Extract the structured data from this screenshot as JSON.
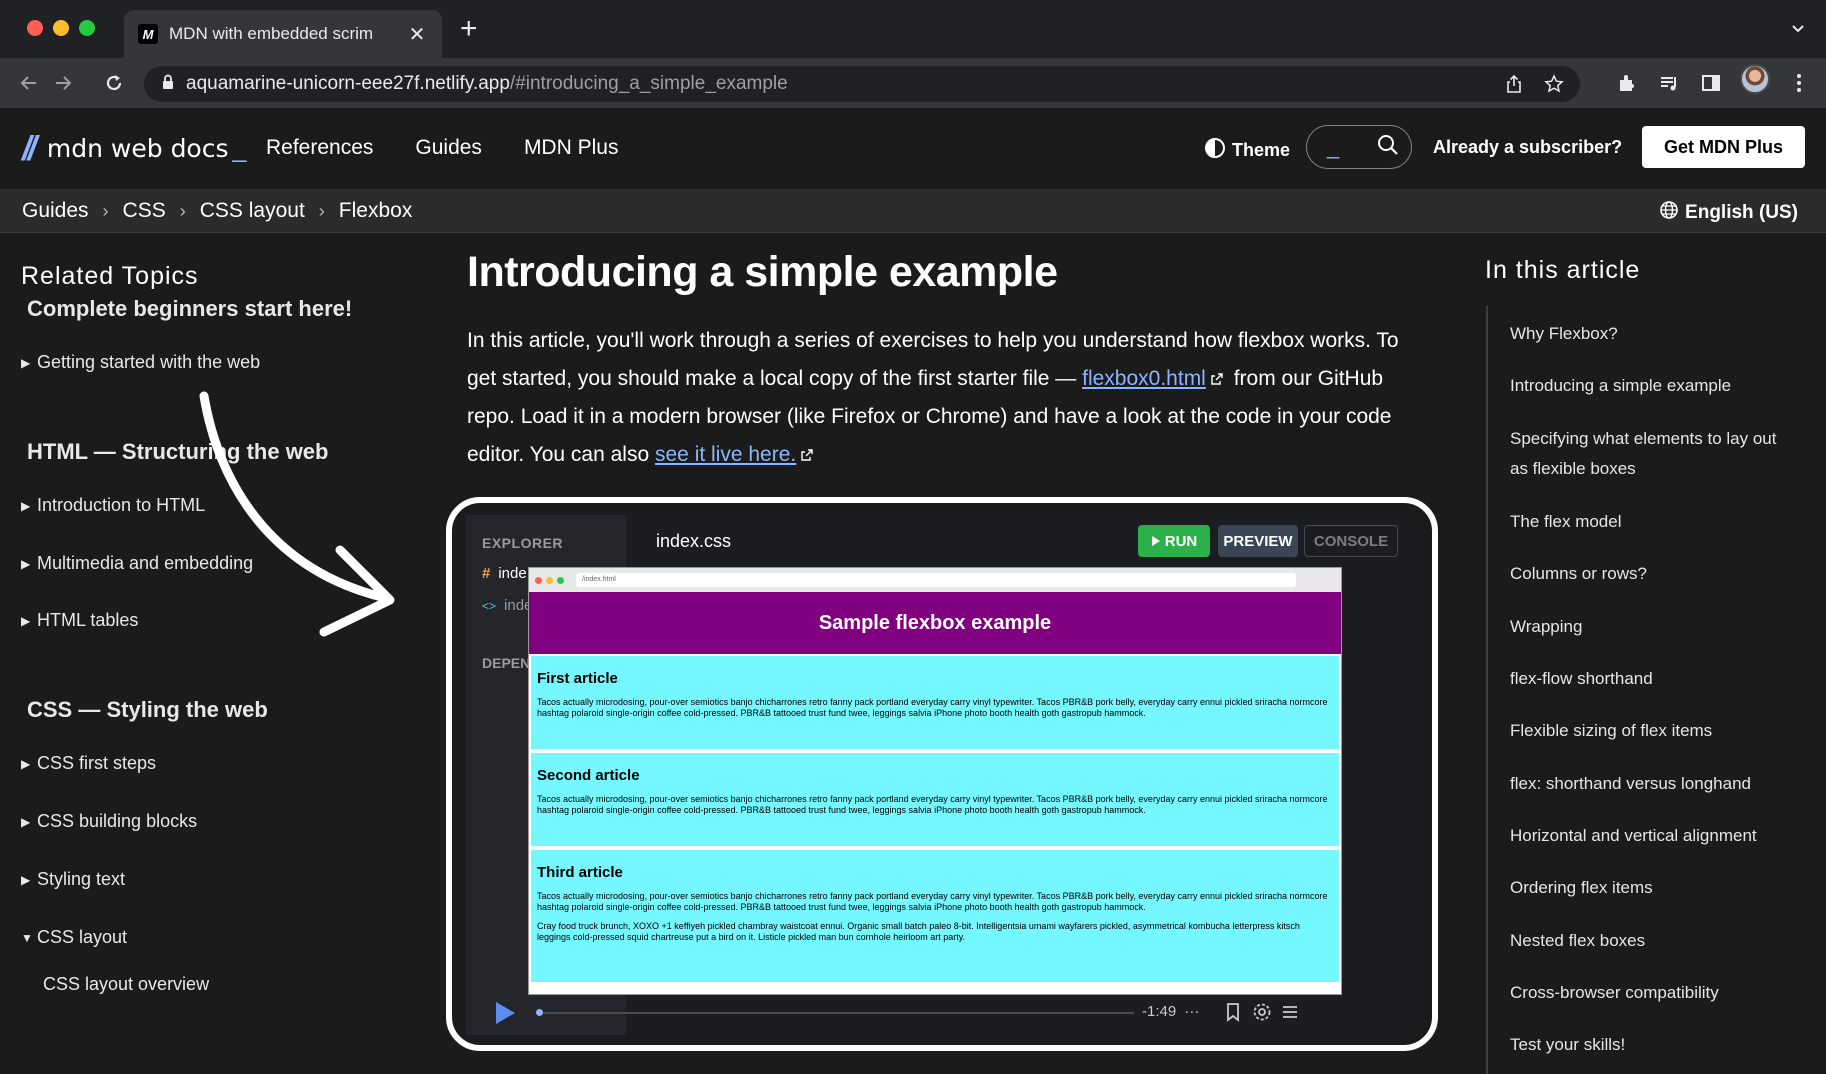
{
  "browser": {
    "tab_title": "MDN with embedded scrim",
    "tab_favicon": "M",
    "url_host": "aquamarine-unicorn-eee27f.netlify.app",
    "url_path": "/#introducing_a_simple_example"
  },
  "header": {
    "logo_text": "mdn web docs",
    "logo_underscore": "_",
    "nav": [
      "References",
      "Guides",
      "MDN Plus"
    ],
    "theme_label": "Theme",
    "subscriber_label": "Already a subscriber?",
    "cta_label": "Get MDN Plus"
  },
  "breadcrumbs": [
    "Guides",
    "CSS",
    "CSS layout",
    "Flexbox"
  ],
  "language": "English (US)",
  "sidebar": {
    "title": "Related Topics",
    "sections": [
      {
        "heading": "Complete beginners start here!",
        "items": [
          "Getting started with the web"
        ]
      },
      {
        "heading": "HTML — Structuring the web",
        "items": [
          "Introduction to HTML",
          "Multimedia and embedding",
          "HTML tables"
        ]
      },
      {
        "heading": "CSS — Styling the web",
        "items": [
          "CSS first steps",
          "CSS building blocks",
          "Styling text",
          "CSS layout"
        ]
      }
    ],
    "sub_items": [
      "CSS layout overview"
    ]
  },
  "article": {
    "title": "Introducing a simple example",
    "p1": "In this article, you'll work through a series of exercises to help you understand how flexbox works. To get started, you should make a local copy of the first starter file — ",
    "link1": "flexbox0.html",
    "p2": " from our GitHub repo. Load it in a modern browser (like Firefox or Chrome) and have a look at the code in your code editor. You can also ",
    "link2": "see it live here."
  },
  "scrim": {
    "explorer_label": "EXPLORER",
    "file1_prefix": "#",
    "file1": "inde",
    "file2_prefix": "<>",
    "file2": "inde",
    "deps_label": "DEPENE",
    "editor_tab": "index.css",
    "run_label": "RUN",
    "preview_label": "PREVIEW",
    "console_label": "CONSOLE",
    "preview_url": "/index.html",
    "preview_header": "Sample flexbox example",
    "articles": [
      {
        "title": "First article",
        "body": "Tacos actually microdosing, pour-over semiotics banjo chicharrones retro fanny pack portland everyday carry vinyl typewriter. Tacos PBR&B pork belly, everyday carry ennui pickled sriracha normcore hashtag polaroid single-origin coffee cold-pressed. PBR&B tattooed trust fund twee, leggings salvia iPhone photo booth health goth gastropub hammock."
      },
      {
        "title": "Second article",
        "body": "Tacos actually microdosing, pour-over semiotics banjo chicharrones retro fanny pack portland everyday carry vinyl typewriter. Tacos PBR&B pork belly, everyday carry ennui pickled sriracha normcore hashtag polaroid single-origin coffee cold-pressed. PBR&B tattooed trust fund twee, leggings salvia iPhone photo booth health goth gastropub hammock."
      },
      {
        "title": "Third article",
        "body": "Tacos actually microdosing, pour-over semiotics banjo chicharrones retro fanny pack portland everyday carry vinyl typewriter. Tacos PBR&B pork belly, everyday carry ennui pickled sriracha normcore hashtag polaroid single-origin coffee cold-pressed. PBR&B tattooed trust fund twee, leggings salvia iPhone photo booth health goth gastropub hammock.",
        "body2": "Cray food truck brunch, XOXO +1 keffiyeh pickled chambray waistcoat ennui. Organic small batch paleo 8-bit. Intelligentsia umami wayfarers pickled, asymmetrical kombucha letterpress kitsch leggings cold-pressed squid chartreuse put a bird on it. Listicle pickled man bun cornhole heirloom art party."
      }
    ],
    "time_remaining": "-1:49",
    "more_dots": "···"
  },
  "toc": {
    "title": "In this article",
    "items": [
      "Why Flexbox?",
      "Introducing a simple example",
      "Specifying what elements to lay out as flexible boxes",
      "The flex model",
      "Columns or rows?",
      "Wrapping",
      "flex-flow shorthand",
      "Flexible sizing of flex items",
      "flex: shorthand versus longhand",
      "Horizontal and vertical alignment",
      "Ordering flex items",
      "Nested flex boxes",
      "Cross-browser compatibility",
      "Test your skills!"
    ]
  },
  "colors": {
    "accent": "#8cb4ff",
    "run_green": "#2bb04a",
    "preview_header": "#800080",
    "preview_article": "#75f7ff"
  },
  "icons": [
    "close-icon",
    "plus-icon",
    "back-arrow-icon",
    "forward-arrow-icon",
    "reload-icon",
    "lock-icon",
    "share-icon",
    "star-icon",
    "extensions-icon",
    "media-icon",
    "sidepanel-icon",
    "kebab-menu-icon",
    "theme-icon",
    "search-icon",
    "globe-icon",
    "external-link-icon",
    "play-icon",
    "bookmark-icon",
    "settings-icon",
    "menu-icon",
    "curved-arrow-icon"
  ]
}
